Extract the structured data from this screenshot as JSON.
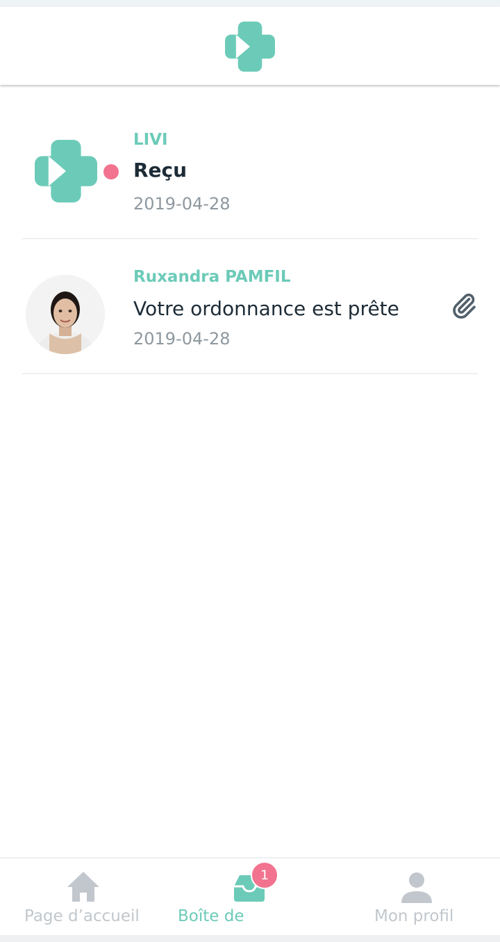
{
  "colors": {
    "brand": "#6ccbb8",
    "dark_text": "#1c2b36",
    "muted_text": "#8e989f",
    "unread": "#f2738f",
    "nav_inactive": "#c1c7cc"
  },
  "header": {
    "logo_icon": "livi-logo-icon"
  },
  "messages": [
    {
      "sender": "LIVI",
      "subject": "Reçu",
      "date": "2019-04-28",
      "unread": true,
      "icon": "livi-logo-icon"
    },
    {
      "sender": "Ruxandra PAMFIL",
      "subject": "Votre ordonnance est prête",
      "date": "2019-04-28",
      "unread": false,
      "icon": "doctor-avatar",
      "attachment_icon": "paperclip-icon"
    }
  ],
  "nav": {
    "home": {
      "label": "Page d’accueil",
      "icon": "home-icon",
      "active": false
    },
    "inbox": {
      "label": "Boîte de",
      "icon": "inbox-icon",
      "active": true,
      "badge": "1"
    },
    "profile": {
      "label": "Mon profil",
      "icon": "user-icon",
      "active": false
    }
  }
}
